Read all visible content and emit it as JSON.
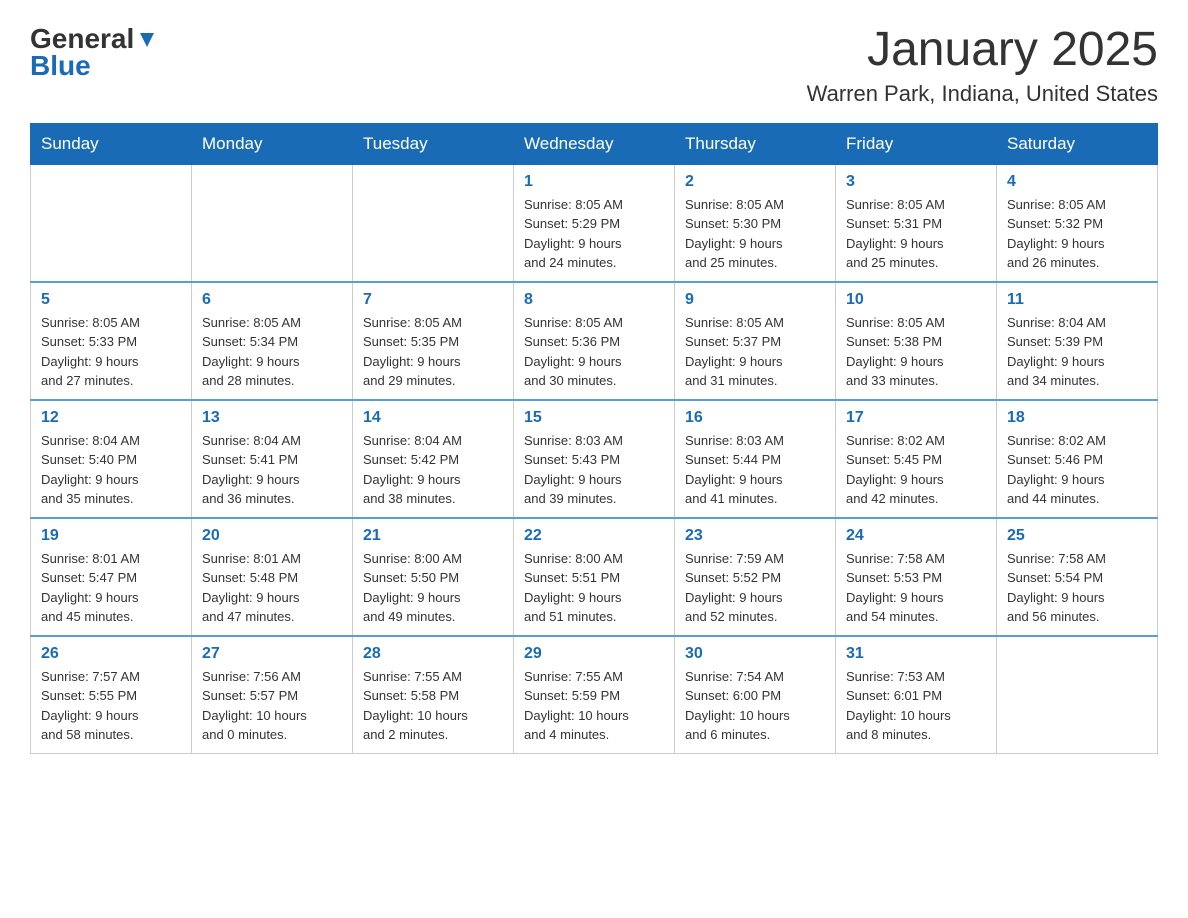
{
  "logo": {
    "general": "General",
    "blue": "Blue"
  },
  "header": {
    "month": "January 2025",
    "location": "Warren Park, Indiana, United States"
  },
  "days_of_week": [
    "Sunday",
    "Monday",
    "Tuesday",
    "Wednesday",
    "Thursday",
    "Friday",
    "Saturday"
  ],
  "weeks": [
    [
      {
        "day": "",
        "info": ""
      },
      {
        "day": "",
        "info": ""
      },
      {
        "day": "",
        "info": ""
      },
      {
        "day": "1",
        "info": "Sunrise: 8:05 AM\nSunset: 5:29 PM\nDaylight: 9 hours\nand 24 minutes."
      },
      {
        "day": "2",
        "info": "Sunrise: 8:05 AM\nSunset: 5:30 PM\nDaylight: 9 hours\nand 25 minutes."
      },
      {
        "day": "3",
        "info": "Sunrise: 8:05 AM\nSunset: 5:31 PM\nDaylight: 9 hours\nand 25 minutes."
      },
      {
        "day": "4",
        "info": "Sunrise: 8:05 AM\nSunset: 5:32 PM\nDaylight: 9 hours\nand 26 minutes."
      }
    ],
    [
      {
        "day": "5",
        "info": "Sunrise: 8:05 AM\nSunset: 5:33 PM\nDaylight: 9 hours\nand 27 minutes."
      },
      {
        "day": "6",
        "info": "Sunrise: 8:05 AM\nSunset: 5:34 PM\nDaylight: 9 hours\nand 28 minutes."
      },
      {
        "day": "7",
        "info": "Sunrise: 8:05 AM\nSunset: 5:35 PM\nDaylight: 9 hours\nand 29 minutes."
      },
      {
        "day": "8",
        "info": "Sunrise: 8:05 AM\nSunset: 5:36 PM\nDaylight: 9 hours\nand 30 minutes."
      },
      {
        "day": "9",
        "info": "Sunrise: 8:05 AM\nSunset: 5:37 PM\nDaylight: 9 hours\nand 31 minutes."
      },
      {
        "day": "10",
        "info": "Sunrise: 8:05 AM\nSunset: 5:38 PM\nDaylight: 9 hours\nand 33 minutes."
      },
      {
        "day": "11",
        "info": "Sunrise: 8:04 AM\nSunset: 5:39 PM\nDaylight: 9 hours\nand 34 minutes."
      }
    ],
    [
      {
        "day": "12",
        "info": "Sunrise: 8:04 AM\nSunset: 5:40 PM\nDaylight: 9 hours\nand 35 minutes."
      },
      {
        "day": "13",
        "info": "Sunrise: 8:04 AM\nSunset: 5:41 PM\nDaylight: 9 hours\nand 36 minutes."
      },
      {
        "day": "14",
        "info": "Sunrise: 8:04 AM\nSunset: 5:42 PM\nDaylight: 9 hours\nand 38 minutes."
      },
      {
        "day": "15",
        "info": "Sunrise: 8:03 AM\nSunset: 5:43 PM\nDaylight: 9 hours\nand 39 minutes."
      },
      {
        "day": "16",
        "info": "Sunrise: 8:03 AM\nSunset: 5:44 PM\nDaylight: 9 hours\nand 41 minutes."
      },
      {
        "day": "17",
        "info": "Sunrise: 8:02 AM\nSunset: 5:45 PM\nDaylight: 9 hours\nand 42 minutes."
      },
      {
        "day": "18",
        "info": "Sunrise: 8:02 AM\nSunset: 5:46 PM\nDaylight: 9 hours\nand 44 minutes."
      }
    ],
    [
      {
        "day": "19",
        "info": "Sunrise: 8:01 AM\nSunset: 5:47 PM\nDaylight: 9 hours\nand 45 minutes."
      },
      {
        "day": "20",
        "info": "Sunrise: 8:01 AM\nSunset: 5:48 PM\nDaylight: 9 hours\nand 47 minutes."
      },
      {
        "day": "21",
        "info": "Sunrise: 8:00 AM\nSunset: 5:50 PM\nDaylight: 9 hours\nand 49 minutes."
      },
      {
        "day": "22",
        "info": "Sunrise: 8:00 AM\nSunset: 5:51 PM\nDaylight: 9 hours\nand 51 minutes."
      },
      {
        "day": "23",
        "info": "Sunrise: 7:59 AM\nSunset: 5:52 PM\nDaylight: 9 hours\nand 52 minutes."
      },
      {
        "day": "24",
        "info": "Sunrise: 7:58 AM\nSunset: 5:53 PM\nDaylight: 9 hours\nand 54 minutes."
      },
      {
        "day": "25",
        "info": "Sunrise: 7:58 AM\nSunset: 5:54 PM\nDaylight: 9 hours\nand 56 minutes."
      }
    ],
    [
      {
        "day": "26",
        "info": "Sunrise: 7:57 AM\nSunset: 5:55 PM\nDaylight: 9 hours\nand 58 minutes."
      },
      {
        "day": "27",
        "info": "Sunrise: 7:56 AM\nSunset: 5:57 PM\nDaylight: 10 hours\nand 0 minutes."
      },
      {
        "day": "28",
        "info": "Sunrise: 7:55 AM\nSunset: 5:58 PM\nDaylight: 10 hours\nand 2 minutes."
      },
      {
        "day": "29",
        "info": "Sunrise: 7:55 AM\nSunset: 5:59 PM\nDaylight: 10 hours\nand 4 minutes."
      },
      {
        "day": "30",
        "info": "Sunrise: 7:54 AM\nSunset: 6:00 PM\nDaylight: 10 hours\nand 6 minutes."
      },
      {
        "day": "31",
        "info": "Sunrise: 7:53 AM\nSunset: 6:01 PM\nDaylight: 10 hours\nand 8 minutes."
      },
      {
        "day": "",
        "info": ""
      }
    ]
  ]
}
